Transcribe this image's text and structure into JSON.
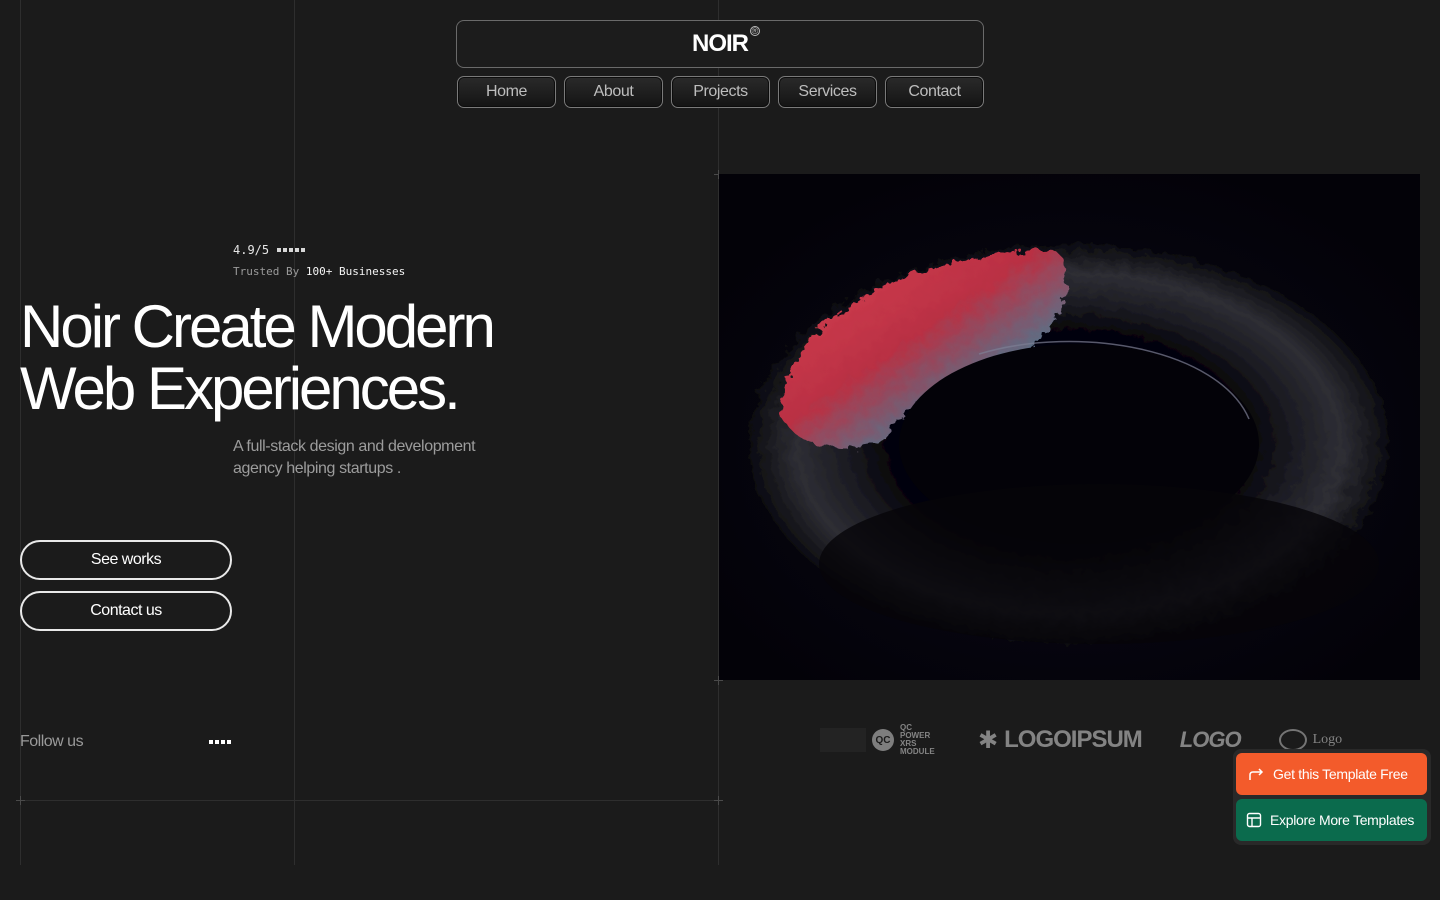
{
  "brand": {
    "name": "NOIR",
    "registered": "®"
  },
  "nav": {
    "items": [
      "Home",
      "About",
      "Projects",
      "Services",
      "Contact"
    ]
  },
  "hero": {
    "rating": "4.9/5",
    "stars": 5,
    "trusted_prefix": "Trusted By",
    "trusted_count": "100+ Businesses",
    "headline_line1": "Noir Create Modern",
    "headline_line2": "Web Experiences.",
    "subtext": "A full-stack design and development agency helping startups .",
    "cta_primary": "See works",
    "cta_secondary": "Contact us"
  },
  "social": {
    "label": "Follow us",
    "icons": [
      "social-icon-1",
      "social-icon-2",
      "social-icon-3",
      "social-icon-4"
    ]
  },
  "logos": {
    "items": [
      "QC POWER XRS MODULE",
      "LOGOIPSUM",
      "LOGO",
      "Logo"
    ]
  },
  "floating": {
    "get_template": "Get this Template Free",
    "explore": "Explore More Templates"
  },
  "colors": {
    "background": "#1b1b1b",
    "accent_orange": "#f35b2b",
    "accent_green": "#0b6b4d"
  }
}
